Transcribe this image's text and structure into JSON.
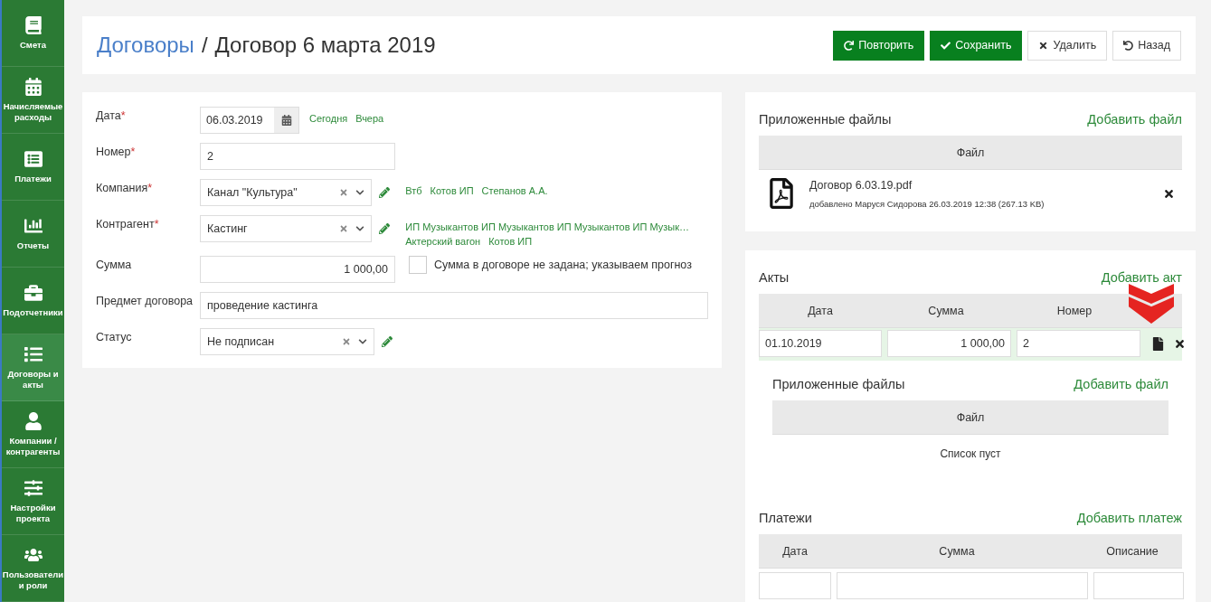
{
  "sidebar": {
    "items": [
      {
        "label": "Смета",
        "selected": false
      },
      {
        "label": "Начисляемые расходы",
        "selected": false
      },
      {
        "label": "Платежи",
        "selected": false
      },
      {
        "label": "Отчеты",
        "selected": false
      },
      {
        "label": "Подотчетники",
        "selected": false
      },
      {
        "label": "Договоры и акты",
        "selected": true
      },
      {
        "label": "Компании / контрагенты",
        "selected": false
      },
      {
        "label": "Настройки проекта",
        "selected": false
      },
      {
        "label": "Пользователи и роли",
        "selected": false
      }
    ]
  },
  "header": {
    "breadcrumb": "Договоры",
    "separator": "/",
    "title": "Договор 6 марта 2019",
    "buttons": [
      {
        "label": "Повторить",
        "kind": "primary"
      },
      {
        "label": "Сохранить",
        "kind": "primary"
      },
      {
        "label": "Удалить",
        "kind": "default"
      },
      {
        "label": "Назад",
        "kind": "default"
      }
    ]
  },
  "form": {
    "fields": [
      {
        "label": "Дата",
        "required_mark": "*",
        "kind": "date",
        "value": "06.03.2019",
        "links": [
          "Сегодня",
          "Вчера"
        ]
      },
      {
        "label": "Номер",
        "required_mark": "*",
        "kind": "text",
        "value": "2"
      },
      {
        "label": "Компания",
        "required_mark": "*",
        "kind": "select",
        "value": "Канал \"Культура\"",
        "links": [
          "Втб",
          "Котов ИП",
          "Степанов А.А."
        ]
      },
      {
        "label": "Контрагент",
        "required_mark": "*",
        "kind": "select",
        "value": "Кастинг",
        "links": [
          "ИП Музыкантов ИП Музыкантов ИП Музыкантов ИП Музык…",
          "Актерский вагон",
          "Котов ИП"
        ]
      },
      {
        "label": "Сумма",
        "kind": "money",
        "value": "1 000,00",
        "checkbox": {
          "label": "Сумма в договоре не задана; указываем прогноз",
          "checked": false
        }
      },
      {
        "label": "Предмет договора",
        "kind": "wide",
        "value": "проведение кастинга"
      },
      {
        "label": "Статус",
        "kind": "select",
        "value": "Не подписан"
      }
    ]
  },
  "files": {
    "title": "Приложенные файлы",
    "add_link": "Добавить файл",
    "column": "Файл",
    "rows": [
      {
        "name": "Договор 6.03.19.pdf",
        "meta": "добавлено Маруся Сидорова 26.03.2019 12:38 (267.13 KB)"
      }
    ]
  },
  "acts": {
    "title": "Акты",
    "add_link": "Добавить акт",
    "columns": [
      "Дата",
      "Сумма",
      "Номер"
    ],
    "rows": [
      {
        "date": "01.10.2019",
        "sum": "1 000,00",
        "number": "2",
        "selected": true
      }
    ],
    "files": {
      "title": "Приложенные файлы",
      "add_link": "Добавить файл",
      "column": "Файл",
      "empty": "Список пуст"
    }
  },
  "payments": {
    "title": "Платежи",
    "add_link": "Добавить платеж",
    "columns": [
      "Дата",
      "Сумма",
      "Описание"
    ],
    "rows": [
      {
        "kind": "input"
      }
    ]
  }
}
